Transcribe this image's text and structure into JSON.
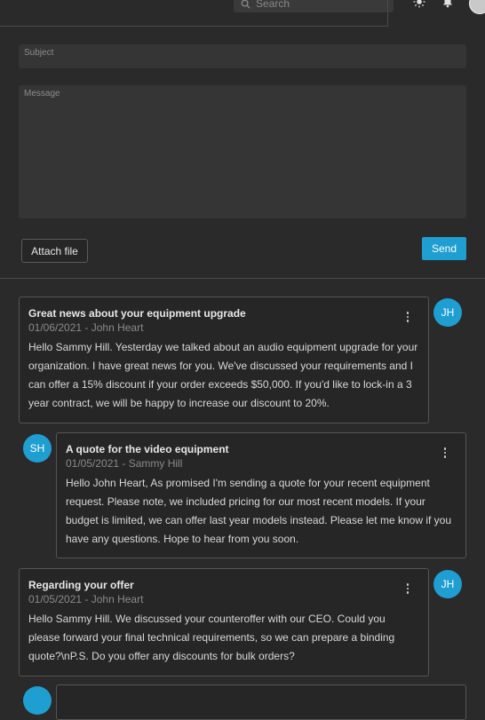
{
  "header": {
    "search_placeholder": "Search"
  },
  "compose": {
    "subject_label": "Subject",
    "message_label": "Message",
    "attach_label": "Attach file",
    "send_label": "Send"
  },
  "messages": [
    {
      "title": "Great news about your equipment upgrade",
      "meta": "01/06/2021 - John Heart",
      "initials": "JH",
      "body": "Hello Sammy Hill. Yesterday we talked about an audio equipment upgrade for your organization. I have great news for you. We've discussed your requirements and I can offer a 15% discount if your order exceeds $50,000. If you'd like to lock-in a 3 year contract, we will be happy to increase our discount to 20%."
    },
    {
      "title": "A quote for the video equipment",
      "meta": "01/05/2021 - Sammy Hill",
      "initials": "SH",
      "body": "Hello John Heart, As promised I'm sending a quote for your recent equipment request. Please note, we included pricing for our most recent models. If your budget is limited, we can offer last year models instead. Please let me know if you have any questions. Hope to hear from you soon."
    },
    {
      "title": "Regarding your offer",
      "meta": "01/05/2021 - John Heart",
      "initials": "JH",
      "body": "Hello Sammy Hill. We discussed your counteroffer with our CEO. Could you please forward your final technical requirements, so we can prepare a binding quote?\\nP.S. Do you offer any discounts for bulk orders?"
    }
  ],
  "colors": {
    "accent": "#1f9ed1",
    "background": "#2a2a2a"
  }
}
